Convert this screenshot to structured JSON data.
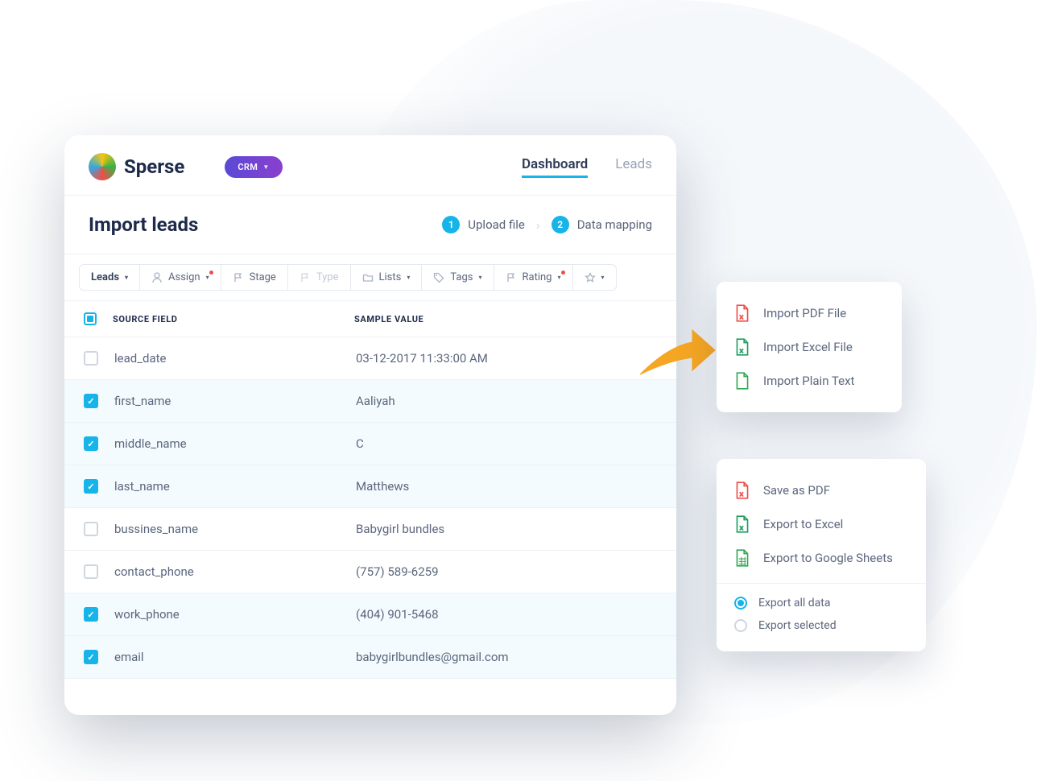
{
  "brand": {
    "name": "Sperse"
  },
  "crm_pill": {
    "label": "CRM"
  },
  "nav": {
    "tabs": [
      {
        "label": "Dashboard",
        "active": true
      },
      {
        "label": "Leads",
        "active": false
      }
    ]
  },
  "page": {
    "title": "Import leads"
  },
  "steps": [
    {
      "num": "1",
      "label": "Upload file"
    },
    {
      "num": "2",
      "label": "Data mapping"
    }
  ],
  "toolbar": {
    "leads": "Leads",
    "assign": "Assign",
    "stage": "Stage",
    "type": "Type",
    "lists": "Lists",
    "tags": "Tags",
    "rating": "Rating"
  },
  "table": {
    "header_source": "SOURCE FIELD",
    "header_sample": "SAMPLE VALUE",
    "rows": [
      {
        "checked": false,
        "source": "lead_date",
        "sample": "03-12-2017 11:33:00 AM"
      },
      {
        "checked": true,
        "source": "first_name",
        "sample": "Aaliyah"
      },
      {
        "checked": true,
        "source": "middle_name",
        "sample": "C"
      },
      {
        "checked": true,
        "source": "last_name",
        "sample": "Matthews"
      },
      {
        "checked": false,
        "source": "bussines_name",
        "sample": "Babygirl bundles"
      },
      {
        "checked": false,
        "source": "contact_phone",
        "sample": "(757) 589-6259"
      },
      {
        "checked": true,
        "source": "work_phone",
        "sample": "(404) 901-5468"
      },
      {
        "checked": true,
        "source": "email",
        "sample": "babygirlbundles@gmail.com"
      }
    ]
  },
  "import_menu": {
    "items": [
      {
        "label": "Import PDF File",
        "icon": "pdf"
      },
      {
        "label": "Import Excel File",
        "icon": "excel"
      },
      {
        "label": "Import Plain Text",
        "icon": "plain"
      }
    ]
  },
  "export_menu": {
    "items": [
      {
        "label": "Save as PDF",
        "icon": "pdf"
      },
      {
        "label": "Export to Excel",
        "icon": "excel"
      },
      {
        "label": "Export to Google Sheets",
        "icon": "sheets"
      }
    ],
    "radios": [
      {
        "label": "Export all data",
        "selected": true
      },
      {
        "label": "Export selected",
        "selected": false
      }
    ]
  },
  "colors": {
    "accent": "#17b4e9",
    "brand_purple": "#6a44d1",
    "red": "#ef4d48",
    "green": "#34a853",
    "excel_green": "#1d9e60",
    "text_muted": "#5b667d"
  }
}
